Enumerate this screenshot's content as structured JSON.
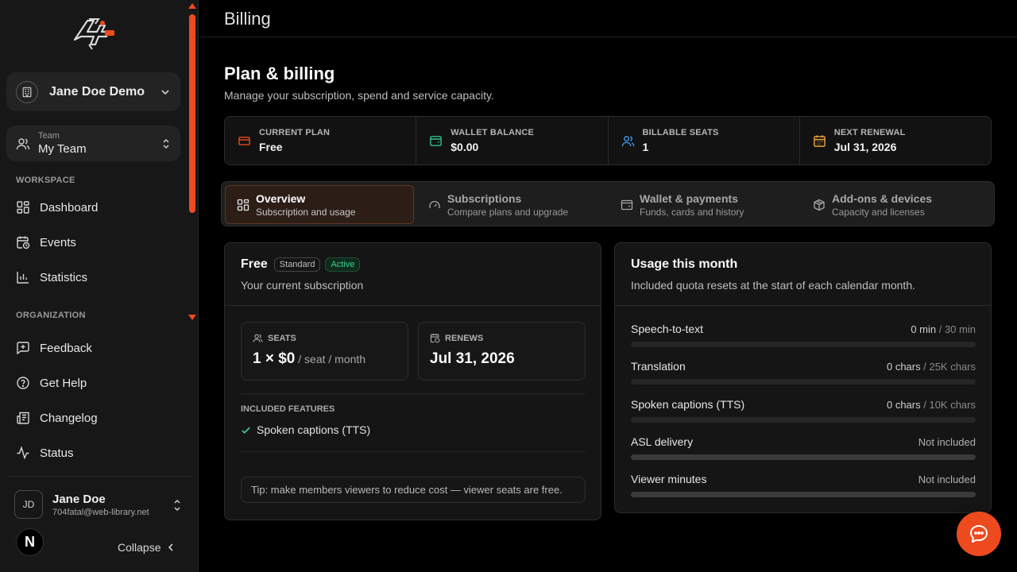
{
  "colors": {
    "accent": "#ee4a1f",
    "success": "#3fd08e",
    "wallet": "#2fc28a",
    "seats": "#4a9df0",
    "renewal": "#f0a53a"
  },
  "sidebar": {
    "logo": {
      "icon": "brand-logo-icon"
    },
    "org": {
      "name": "Jane Doe Demo",
      "icon": "building-icon"
    },
    "team": {
      "label": "Team",
      "value": "My Team",
      "icon": "users-icon"
    },
    "workspace_label": "WORKSPACE",
    "workspace_items": [
      {
        "label": "Dashboard",
        "icon": "dashboard-icon"
      },
      {
        "label": "Events",
        "icon": "calendar-clock-icon"
      },
      {
        "label": "Statistics",
        "icon": "bar-chart-icon"
      }
    ],
    "organization_label": "ORGANIZATION",
    "organization_items": [
      {
        "label": "Feedback",
        "icon": "message-plus-icon"
      },
      {
        "label": "Get Help",
        "icon": "help-circle-icon"
      },
      {
        "label": "Changelog",
        "icon": "newspaper-icon"
      },
      {
        "label": "Status",
        "icon": "activity-icon"
      }
    ],
    "user": {
      "initials": "JD",
      "name": "Jane Doe",
      "email": "704fatal@web-library.net"
    },
    "next_badge": "N",
    "collapse_label": "Collapse"
  },
  "header": {
    "title": "Billing"
  },
  "page": {
    "title": "Plan & billing",
    "subtitle": "Manage your subscription, spend and service capacity."
  },
  "stats": [
    {
      "label": "CURRENT PLAN",
      "value": "Free",
      "icon": "credit-card-icon"
    },
    {
      "label": "WALLET BALANCE",
      "value": "$0.00",
      "icon": "wallet-icon"
    },
    {
      "label": "BILLABLE SEATS",
      "value": "1",
      "icon": "users-icon"
    },
    {
      "label": "NEXT RENEWAL",
      "value": "Jul 31, 2026",
      "icon": "calendar-icon"
    }
  ],
  "tabs": [
    {
      "title": "Overview",
      "subtitle": "Subscription and usage",
      "icon": "grid-icon",
      "active": true
    },
    {
      "title": "Subscriptions",
      "subtitle": "Compare plans and upgrade",
      "icon": "gauge-icon",
      "active": false
    },
    {
      "title": "Wallet & payments",
      "subtitle": "Funds, cards and history",
      "icon": "wallet-icon",
      "active": false
    },
    {
      "title": "Add-ons & devices",
      "subtitle": "Capacity and licenses",
      "icon": "package-icon",
      "active": false
    }
  ],
  "plan": {
    "name": "Free",
    "tier_badge": "Standard",
    "status_badge": "Active",
    "subtitle": "Your current subscription",
    "seats": {
      "label": "SEATS",
      "value": "1 × $0",
      "unit": " / seat / month",
      "icon": "users-icon"
    },
    "renews": {
      "label": "RENEWS",
      "value": "Jul 31, 2026",
      "icon": "calendar-clock-icon"
    },
    "features_label": "INCLUDED FEATURES",
    "features": [
      "Spoken captions (TTS)"
    ],
    "tip": "Tip: make members viewers to reduce cost — viewer seats are free."
  },
  "usage": {
    "title": "Usage this month",
    "subtitle": "Included quota resets at the start of each calendar month.",
    "meters": [
      {
        "name": "Speech-to-text",
        "used": "0 min",
        "limit": " / 30 min",
        "fraction": 0,
        "included": true
      },
      {
        "name": "Translation",
        "used": "0 chars",
        "limit": " / 25K chars",
        "fraction": 0,
        "included": true
      },
      {
        "name": "Spoken captions (TTS)",
        "used": "0 chars",
        "limit": " / 10K chars",
        "fraction": 0,
        "included": true
      },
      {
        "name": "ASL delivery",
        "used": "Not included",
        "limit": "",
        "fraction": 0,
        "included": false
      },
      {
        "name": "Viewer minutes",
        "used": "Not included",
        "limit": "",
        "fraction": 0,
        "included": false
      }
    ]
  },
  "chat_button": {
    "icon": "chat-bubble-icon"
  }
}
